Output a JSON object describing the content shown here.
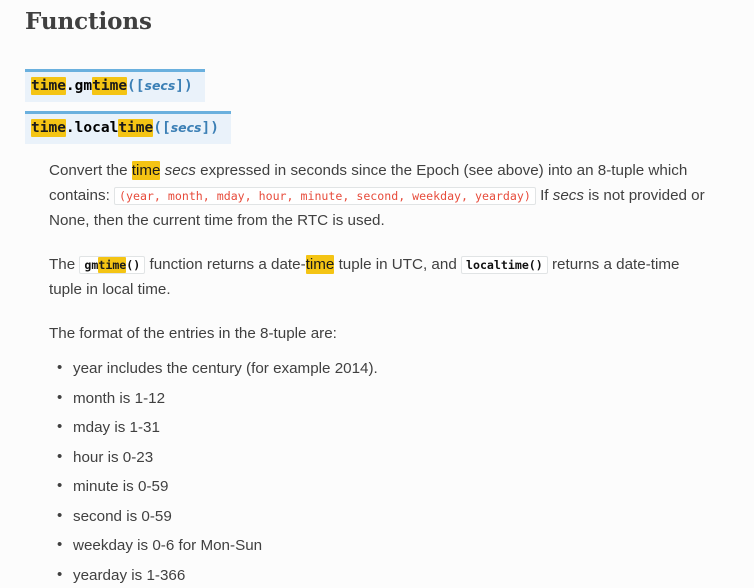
{
  "page": {
    "title": "Functions",
    "background_color": "#fcfcfc",
    "text_color": "#404040",
    "highlight_color": "#f4c414",
    "code_red_color": "#e74c3c",
    "signature_bg_color": "#eaf2fa",
    "signature_border_color": "#6ab0de",
    "signature_accent_color": "#3b7fb5"
  },
  "signatures": [
    {
      "name": "gmtime-signature",
      "module": "time",
      "dot": ".",
      "func_prefix": "gm",
      "func_highlight": "time",
      "open_paren": "(",
      "open_bracket": "[",
      "param": "secs",
      "close_bracket": "]",
      "close_paren": ")",
      "module_highlight": "time"
    },
    {
      "name": "localtime-signature",
      "module": "time",
      "dot": ".",
      "func_prefix": "local",
      "func_highlight": "time",
      "open_paren": "(",
      "open_bracket": "[",
      "param": "secs",
      "close_bracket": "]",
      "close_paren": ")",
      "module_highlight": "time"
    }
  ],
  "paragraphs": {
    "p1": {
      "seg1": "Convert the ",
      "hl1": "time",
      "seg2": " ",
      "em1": "secs",
      "seg3": " expressed in seconds since the Epoch (see above) into an 8-tuple which contains: ",
      "code1": "(year, month, mday, hour, minute, second, weekday, yearday)",
      "seg4": " If ",
      "em2": "secs",
      "seg5": " is not provided or None, then the current time from the RTC is used."
    },
    "p2": {
      "seg1": "The ",
      "code_prefix": "gm",
      "code_hl": "time",
      "code_suffix": "()",
      "seg2": " function returns a date-",
      "hl1": "time",
      "seg3": " tuple in UTC, and ",
      "code2": "localtime()",
      "seg4": " returns a date-time tuple in local time."
    },
    "p3": {
      "text": "The format of the entries in the 8-tuple are:"
    }
  },
  "tuple_fields": [
    "year includes the century (for example 2014).",
    "month is 1-12",
    "mday is 1-31",
    "hour is 0-23",
    "minute is 0-59",
    "second is 0-59",
    "weekday is 0-6 for Mon-Sun",
    "yearday is 1-366"
  ]
}
